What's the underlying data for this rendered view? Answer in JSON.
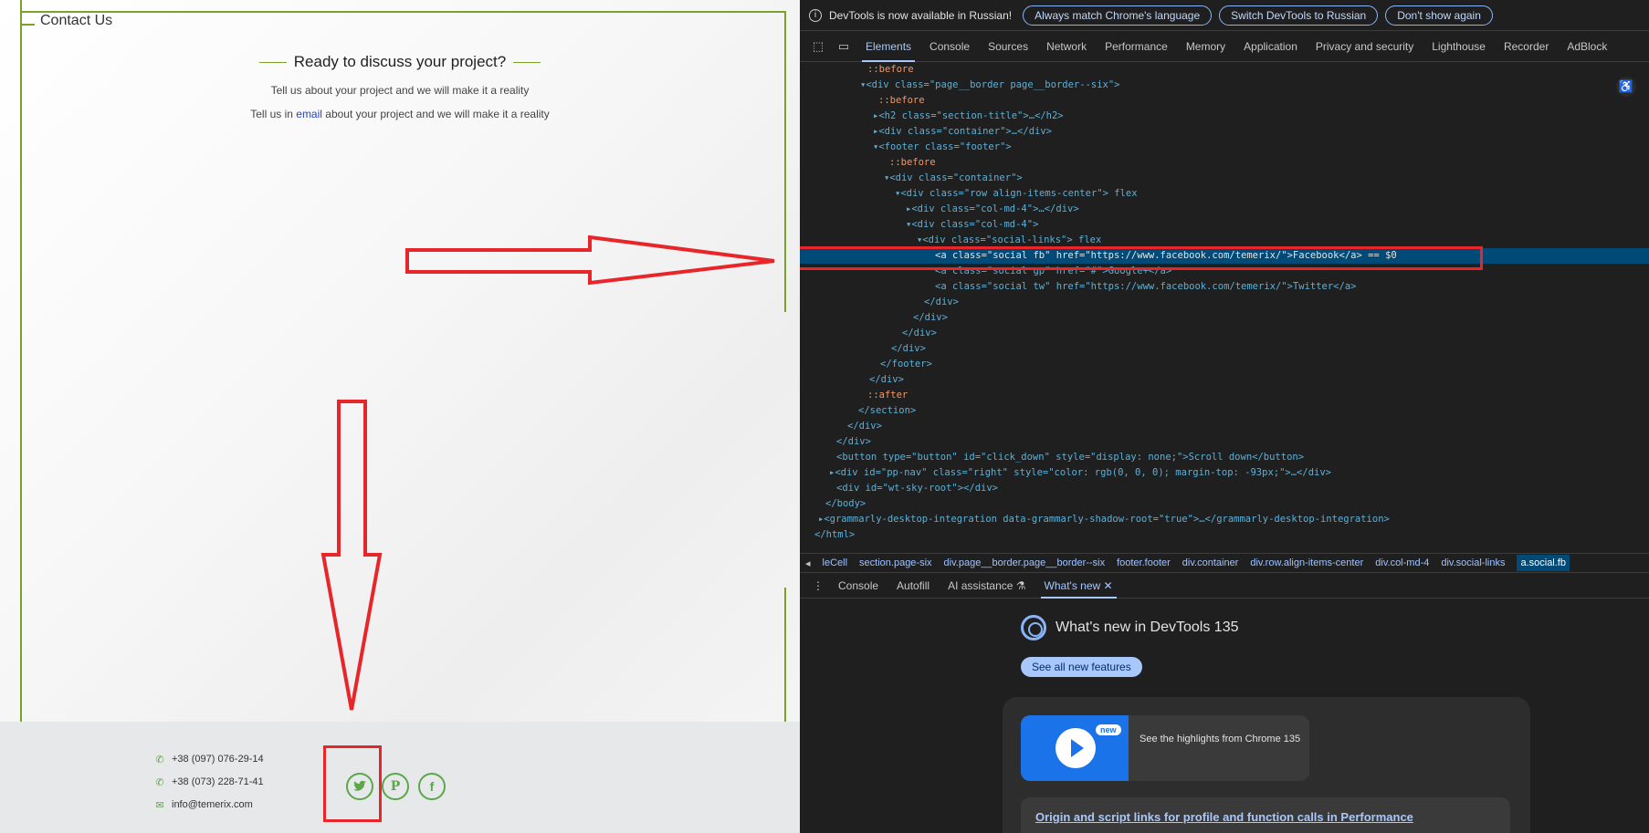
{
  "page": {
    "contact_us": "Contact Us",
    "ready_title": "Ready to discuss your project?",
    "subline_1": "Tell us about your project and we will make it a reality",
    "subline_2_prefix": "Tell us in ",
    "subline_2_link": "email",
    "subline_2_suffix": " about your project and we will make it a reality",
    "phone_1": "+38 (097) 076-29-14",
    "phone_2": "+38 (073) 228-71-41",
    "email": "info@temerix.com",
    "social_icons": [
      "twitter-icon",
      "pinterest-icon",
      "facebook-icon"
    ],
    "accent_color": "#7aa12a",
    "annotation_color": "#e8262a"
  },
  "devtools": {
    "infobar": {
      "message": "DevTools is now available in Russian!",
      "btn_match": "Always match Chrome's language",
      "btn_switch": "Switch DevTools to Russian",
      "btn_dont_show": "Don't show again"
    },
    "tabs": [
      "Elements",
      "Console",
      "Sources",
      "Network",
      "Performance",
      "Memory",
      "Application",
      "Privacy and security",
      "Lighthouse",
      "Recorder",
      "AdBlock"
    ],
    "dom_lines": [
      "::before",
      "<div class=\"page__border page__border--six\">",
      "::before",
      "<h2 class=\"section-title\">…</h2>",
      "<div class=\"container\">…</div>",
      "<footer class=\"footer\">",
      "::before",
      "<div class=\"container\">",
      "<div class=\"row align-items-center\"> flex",
      "<div class=\"col-md-4\">…</div>",
      "<div class=\"col-md-4\">",
      "<div class=\"social-links\"> flex",
      "<a class=\"social fb\" href=\"https://www.facebook.com/temerix/\">Facebook</a> == $0",
      "<a class=\"social gp\" href=\"#\">Google+</a>",
      "<a class=\"social tw\" href=\"https://www.facebook.com/temerix/\">Twitter</a>",
      "</div>",
      "</div>",
      "</div>",
      "</div>",
      "</footer>",
      "</div>",
      "::after",
      "</section>",
      "</div>",
      "</div>",
      "<button type=\"button\" id=\"click_down\" style=\"display: none;\">Scroll down</button>",
      "<div id=\"pp-nav\" class=\"right\" style=\"color: rgb(0, 0, 0); margin-top: -93px;\">…</div>",
      "<div id=\"wt-sky-root\"></div>",
      "</body>",
      "<grammarly-desktop-integration data-grammarly-shadow-root=\"true\">…</grammarly-desktop-integration>",
      "</html>"
    ],
    "breadcrumbs": [
      "leCell",
      "section.page-six",
      "div.page__border.page__border--six",
      "footer.footer",
      "div.container",
      "div.row.align-items-center",
      "div.col-md-4",
      "div.social-links",
      "a.social.fb"
    ],
    "drawer_tabs": [
      "Console",
      "Autofill",
      "AI assistance",
      "What's new"
    ],
    "whats_new_title": "What's new in DevTools 135",
    "see_all": "See all new features",
    "video_badge": "new",
    "video_text": "See the highlights from Chrome 135",
    "feature_link": "Origin and script links for profile and function calls in Performance"
  }
}
